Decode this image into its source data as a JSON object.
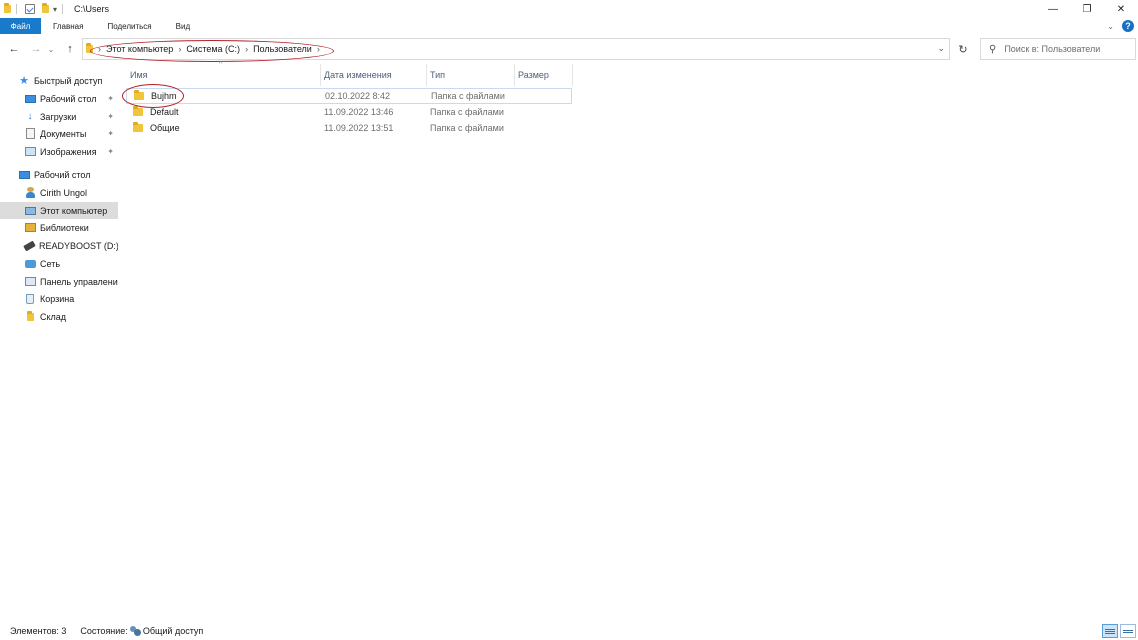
{
  "window": {
    "title": "C:\\Users",
    "minimize_glyph": "—",
    "maximize_glyph": "❐",
    "close_glyph": "✕"
  },
  "ribbon": {
    "tabs": [
      "Файл",
      "Главная",
      "Поделиться",
      "Вид"
    ],
    "collapse_glyph": "⌄",
    "help_glyph": "?"
  },
  "nav": {
    "back_glyph": "←",
    "forward_glyph": "→",
    "recent_glyph": "⌄",
    "up_glyph": "↑",
    "breadcrumb": [
      "Этот компьютер",
      "Система (C:)",
      "Пользователи"
    ],
    "crumb_sep": "›",
    "address_dropdown_glyph": "⌄",
    "refresh_glyph": "↻",
    "search_placeholder": "Поиск в: Пользователи",
    "search_icon": "⚲"
  },
  "sidebar": {
    "items": [
      {
        "label": "Быстрый доступ",
        "icon": "star-icon",
        "pinned": false
      },
      {
        "label": "Рабочий стол",
        "icon": "desktop-icon",
        "pinned": true
      },
      {
        "label": "Загрузки",
        "icon": "download-icon",
        "pinned": true
      },
      {
        "label": "Документы",
        "icon": "document-icon",
        "pinned": true
      },
      {
        "label": "Изображения",
        "icon": "pictures-icon",
        "pinned": true
      },
      {
        "label": "Рабочий стол",
        "icon": "desktop-icon",
        "pinned": false
      },
      {
        "label": "Cirith Ungol",
        "icon": "user-icon",
        "pinned": false
      },
      {
        "label": "Этот компьютер",
        "icon": "computer-icon",
        "pinned": false,
        "selected": true
      },
      {
        "label": "Библиотеки",
        "icon": "libraries-icon",
        "pinned": false
      },
      {
        "label": "READYBOOST (D:)",
        "icon": "usb-drive-icon",
        "pinned": false
      },
      {
        "label": "Сеть",
        "icon": "network-icon",
        "pinned": false
      },
      {
        "label": "Панель управлени",
        "icon": "control-panel-icon",
        "pinned": false
      },
      {
        "label": "Корзина",
        "icon": "recycle-bin-icon",
        "pinned": false
      },
      {
        "label": "Склад",
        "icon": "folder-icon",
        "pinned": false
      }
    ],
    "pin_glyph": "📌",
    "down_glyph": "🡇",
    "star_glyph": "★"
  },
  "file_list": {
    "columns": [
      "Имя",
      "Дата изменения",
      "Тип",
      "Размер"
    ],
    "sort_glyph": "^",
    "rows": [
      {
        "name": "Bujhm",
        "date": "02.10.2022 8:42",
        "type": "Папка с файлами",
        "selected": true
      },
      {
        "name": "Default",
        "date": "11.09.2022 13:46",
        "type": "Папка с файлами",
        "selected": false
      },
      {
        "name": "Общие",
        "date": "11.09.2022 13:51",
        "type": "Папка с файлами",
        "selected": false
      }
    ]
  },
  "status": {
    "count": "Элементов: 3",
    "state_label": "Состояние:",
    "state_value": "Общий доступ"
  },
  "colors": {
    "accent": "#1979ca",
    "annotation": "#b3202a",
    "folder": "#f0c53a"
  }
}
